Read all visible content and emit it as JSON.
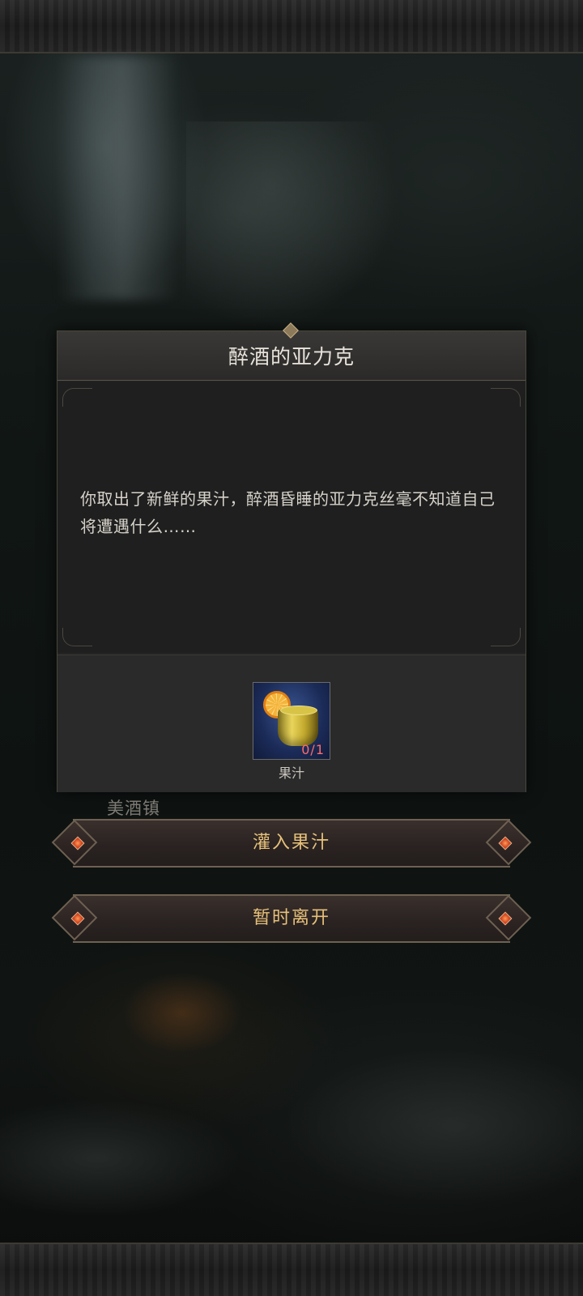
{
  "dialog": {
    "title": "醉酒的亚力克",
    "story": "你取出了新鲜的果汁，醉酒昏睡的亚力克丝毫不知道自己将遭遇什么……",
    "item": {
      "name": "果汁",
      "count": "0/1",
      "icon": "juice-cup-icon"
    }
  },
  "location": {
    "label": "美酒镇"
  },
  "actions": {
    "pour_label": "灌入果汁",
    "leave_label": "暂时离开"
  },
  "colors": {
    "title_text": "#e8e4dc",
    "button_text": "#e7c17a",
    "count_text": "#ff6b6b",
    "gem": "#d2441e"
  }
}
